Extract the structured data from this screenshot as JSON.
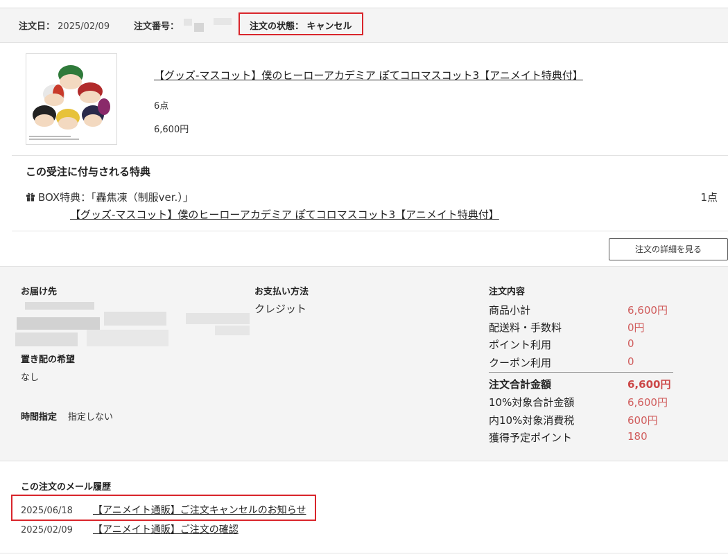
{
  "order": {
    "date_label": "注文日：",
    "date_value": "2025/02/09",
    "number_label": "注文番号：",
    "status_label": "注文の状態：",
    "status_value": "キャンセル"
  },
  "product": {
    "title": "【グッズ-マスコット】僕のヒーローアカデミア ぽてコロマスコット3【アニメイト特典付】",
    "quantity": "6点",
    "price": "6,600円"
  },
  "bonus": {
    "heading": "この受注に付与される特典",
    "icon": "gift-icon",
    "label": "BOX特典：「轟焦凍（制服ver.）」",
    "quantity": "1点",
    "product_link": "【グッズ-マスコット】僕のヒーローアカデミア ぽてコロマスコット3【アニメイト特典付】"
  },
  "detail_button": "注文の詳細を見る",
  "delivery": {
    "heading": "お届け先",
    "okihai_heading": "置き配の希望",
    "okihai_value": "なし",
    "time_label": "時間指定",
    "time_value": "指定しない"
  },
  "payment": {
    "heading": "お支払い方法",
    "method": "クレジット"
  },
  "summary": {
    "heading": "注文内容",
    "rows": [
      {
        "label": "商品小計",
        "value": "6,600円"
      },
      {
        "label": "配送料・手数料",
        "value": "0円"
      },
      {
        "label": "ポイント利用",
        "value": "0"
      },
      {
        "label": "クーポン利用",
        "value": "0"
      }
    ],
    "total": {
      "label": "注文合計金額",
      "value": "6,600円"
    },
    "tax_rows": [
      {
        "label": "10%対象合計金額",
        "value": "6,600円"
      },
      {
        "label": "内10%対象消費税",
        "value": "600円"
      },
      {
        "label": "獲得予定ポイント",
        "value": "180"
      }
    ]
  },
  "mail_history": {
    "heading": "この注文のメール履歴",
    "items": [
      {
        "date": "2025/06/18",
        "subject": "【アニメイト通販】ご注文キャンセルのお知らせ"
      },
      {
        "date": "2025/02/09",
        "subject": "【アニメイト通販】ご注文の確認"
      }
    ]
  },
  "colors": {
    "highlight_border": "#d9252b",
    "price_text": "#d05c5c",
    "panel_background": "#f4f4f4"
  }
}
